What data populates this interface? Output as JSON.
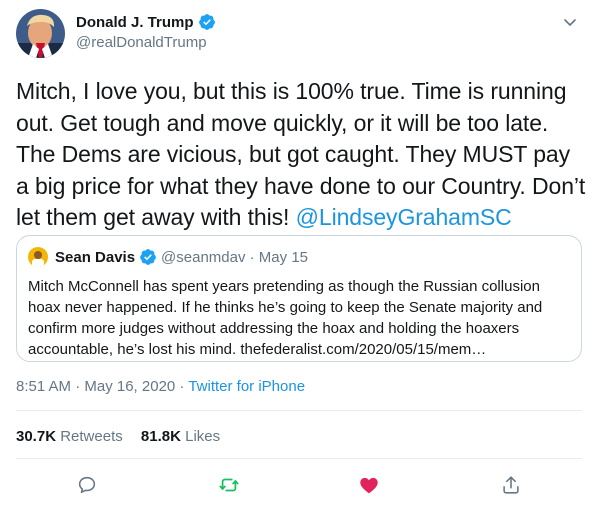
{
  "tweet": {
    "author": {
      "name": "Donald J. Trump",
      "handle": "@realDonaldTrump"
    },
    "text": "Mitch, I love you, but this is 100% true. Time is running out. Get tough and move quickly, or it will be too late. The Dems are vicious, but got caught. They MUST pay a big price for what they have done to our Country. Don’t let them get away with this! ",
    "mention": "@LindseyGrahamSC",
    "timestamp": "8:51 AM · May 16, 2020 · ",
    "source": "Twitter for iPhone",
    "stats": {
      "retweets": "30.7K",
      "retweets_label": "Retweets",
      "likes": "81.8K",
      "likes_label": "Likes"
    }
  },
  "quoted_tweet": {
    "author_name": "Sean Davis",
    "meta": "@seanmdav · May 15",
    "text": "Mitch McConnell has spent years pretending as though the Russian collusion hoax never happened. If he thinks he’s going to keep the Senate majority and confirm more judges without addressing the hoax and holding the hoaxers accountable, he’s lost his mind. thefederalist.com/2020/05/15/mem…"
  },
  "colors": {
    "accent": "#1da1f2",
    "link": "#1b95e0",
    "retweet_green": "#17bf63",
    "like_red": "#e0245e",
    "secondary_text": "#657786"
  },
  "icons": [
    "avatar",
    "verified-badge-icon",
    "chevron-down-icon",
    "reply-icon",
    "retweet-icon",
    "like-icon",
    "share-icon"
  ]
}
